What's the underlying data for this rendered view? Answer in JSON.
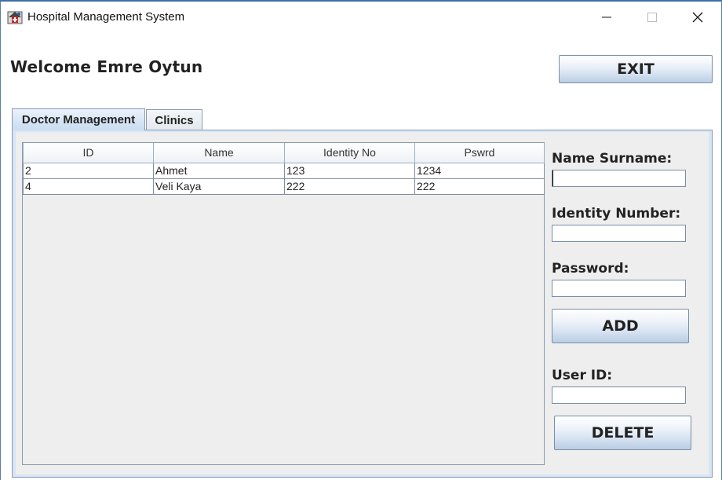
{
  "window": {
    "title": "Hospital Management System",
    "app_icon": "hospital-app-icon",
    "controls": {
      "minimize": "minimize-icon",
      "maximize": "maximize-icon",
      "close": "close-icon"
    }
  },
  "header": {
    "welcome": "Welcome Emre Oytun",
    "exit_label": "EXIT"
  },
  "tabs": [
    {
      "label": "Doctor Management",
      "active": true
    },
    {
      "label": "Clinics",
      "active": false
    }
  ],
  "doctor_table": {
    "columns": [
      "ID",
      "Name",
      "Identity No",
      "Pswrd"
    ],
    "rows": [
      [
        "2",
        "Ahmet",
        "123",
        "1234"
      ],
      [
        "4",
        "Veli Kaya",
        "222",
        "222"
      ]
    ]
  },
  "form": {
    "name_label": "Name Surname:",
    "name_value": "",
    "identity_label": "Identity Number:",
    "identity_value": "",
    "password_label": "Password:",
    "password_value": "",
    "add_label": "ADD",
    "user_id_label": "User ID:",
    "user_id_value": "",
    "delete_label": "DELETE"
  },
  "colors": {
    "title_accent": "#3c6ea8",
    "tab_panel": "#d6e6f6",
    "panel_bg": "#eeeeee"
  }
}
